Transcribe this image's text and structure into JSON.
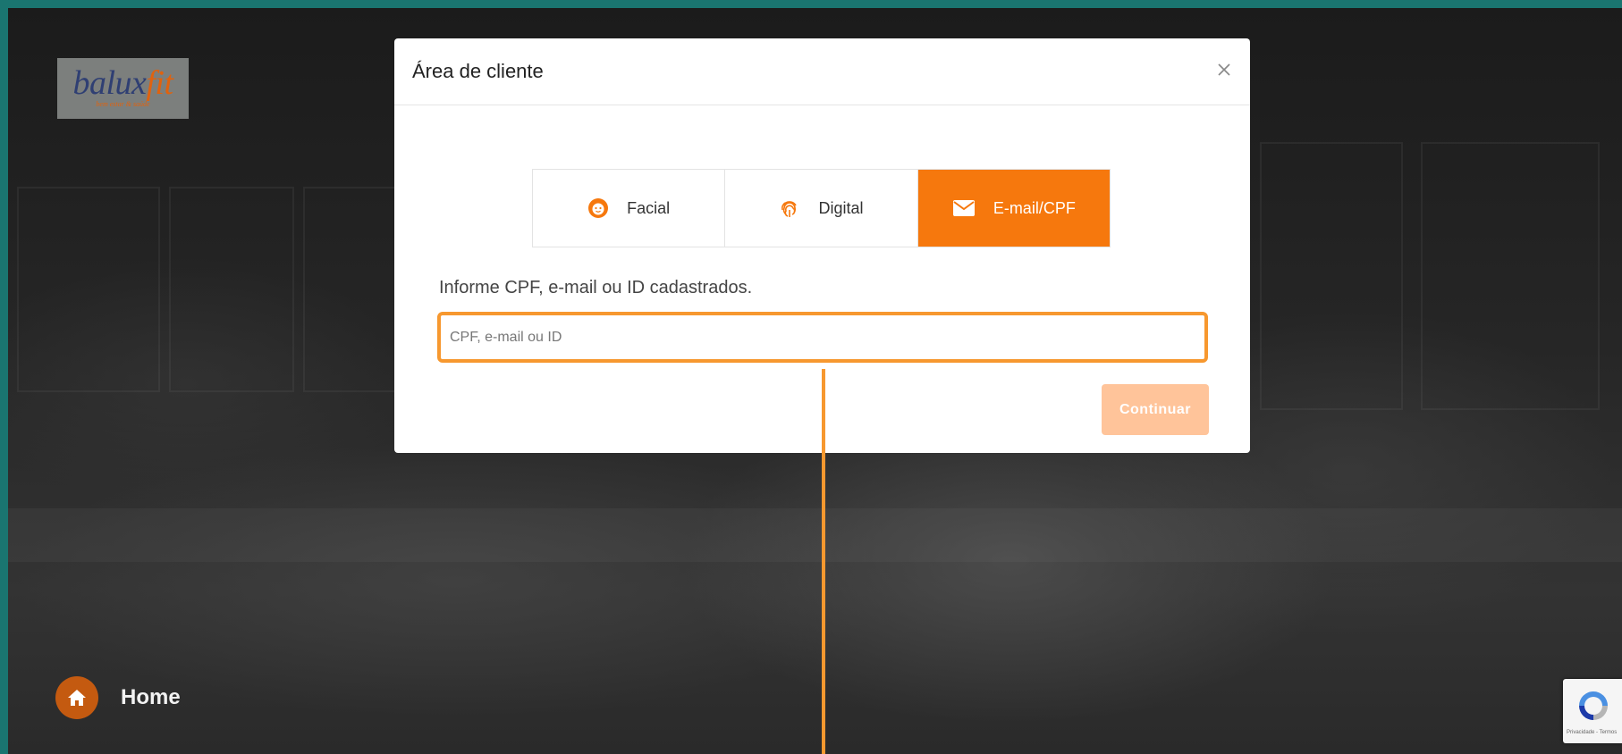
{
  "brand": {
    "logo_word_part1": "balux",
    "logo_word_part2": "fit",
    "logo_tagline": "bem estar & saúde"
  },
  "home": {
    "label": "Home",
    "icon": "home-icon"
  },
  "modal": {
    "title": "Área de cliente",
    "close_icon": "close-icon",
    "tabs": [
      {
        "label": "Facial",
        "icon": "face-icon",
        "active": false
      },
      {
        "label": "Digital",
        "icon": "fingerprint-icon",
        "active": false
      },
      {
        "label": "E-mail/CPF",
        "icon": "envelope-icon",
        "active": true
      }
    ],
    "prompt": "Informe CPF, e-mail ou ID cadastrados.",
    "input": {
      "value": "",
      "placeholder": "CPF, e-mail ou ID"
    },
    "continue_label": "Continuar"
  },
  "recaptcha": {
    "text": "Privacidade - Termos"
  },
  "colors": {
    "frame": "#1a7570",
    "accent": "#f6780d",
    "highlight": "#f7982f",
    "button_disabled": "#ffc49a",
    "home_circle": "#c45a10"
  }
}
